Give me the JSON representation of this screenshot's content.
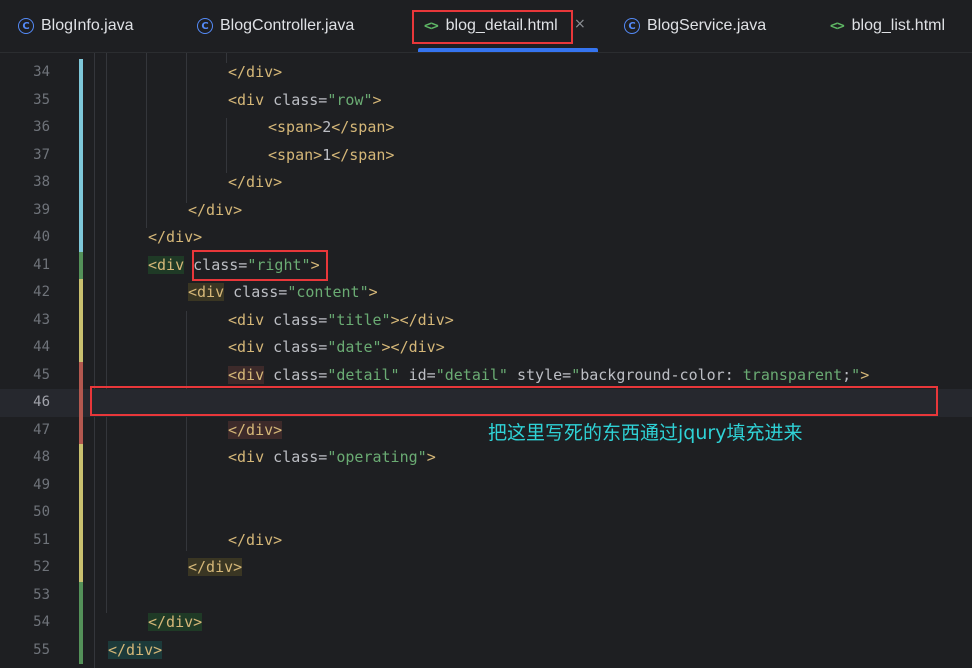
{
  "tabs": [
    {
      "label": "BlogInfo.java",
      "icon": "class-icon"
    },
    {
      "label": "BlogController.java",
      "icon": "class-icon"
    },
    {
      "label": "blog_detail.html",
      "icon": "html-icon",
      "active": true
    },
    {
      "label": "BlogService.java",
      "icon": "class-icon"
    },
    {
      "label": "blog_list.html",
      "icon": "html-icon"
    }
  ],
  "close_glyph": "×",
  "html_glyph": "<>",
  "class_glyph": "C",
  "annotation": "把这里写死的东西通过jqury填充进来",
  "lines": [
    {
      "n": "34",
      "marker": "#7ec7d9",
      "indent": 3,
      "segs": [
        [
          "tag",
          "</div>"
        ]
      ]
    },
    {
      "n": "35",
      "marker": "#7ec7d9",
      "indent": 3,
      "segs": [
        [
          "tag",
          "<div "
        ],
        [
          "attr",
          "class="
        ],
        [
          "str",
          "\"row\""
        ],
        [
          "tag",
          ">"
        ]
      ]
    },
    {
      "n": "36",
      "marker": "#7ec7d9",
      "indent": 4,
      "segs": [
        [
          "tag",
          "<span>"
        ],
        [
          "txt",
          "2"
        ],
        [
          "tag",
          "</span>"
        ]
      ]
    },
    {
      "n": "37",
      "marker": "#7ec7d9",
      "indent": 4,
      "segs": [
        [
          "tag",
          "<span>"
        ],
        [
          "txt",
          "1"
        ],
        [
          "tag",
          "</span>"
        ]
      ]
    },
    {
      "n": "38",
      "marker": "#7ec7d9",
      "indent": 3,
      "segs": [
        [
          "tag",
          "</div>"
        ]
      ]
    },
    {
      "n": "39",
      "marker": "#7ec7d9",
      "indent": 2,
      "segs": [
        [
          "tag",
          "</div>"
        ]
      ]
    },
    {
      "n": "40",
      "marker": "#7ec7d9",
      "indent": 1,
      "segs": [
        [
          "tag",
          "</div>"
        ]
      ]
    },
    {
      "n": "41",
      "marker": "#549159",
      "indent": 1,
      "segs": [
        [
          "tag hl-green",
          "<div"
        ],
        [
          "txt",
          " "
        ],
        [
          "attr",
          "class="
        ],
        [
          "str",
          "\"right\""
        ],
        [
          "tag",
          ">"
        ]
      ]
    },
    {
      "n": "42",
      "marker": "#c9c06f",
      "indent": 2,
      "segs": [
        [
          "tag hl-yellow",
          "<div"
        ],
        [
          "txt",
          " "
        ],
        [
          "attr",
          "class="
        ],
        [
          "str",
          "\"content\""
        ],
        [
          "tag",
          ">"
        ]
      ]
    },
    {
      "n": "43",
      "marker": "#c9c06f",
      "indent": 3,
      "segs": [
        [
          "tag",
          "<div "
        ],
        [
          "attr",
          "class="
        ],
        [
          "str",
          "\"title\""
        ],
        [
          "tag",
          "></div>"
        ]
      ]
    },
    {
      "n": "44",
      "marker": "#c9c06f",
      "indent": 3,
      "segs": [
        [
          "tag",
          "<div "
        ],
        [
          "attr",
          "class="
        ],
        [
          "str",
          "\"date\""
        ],
        [
          "tag",
          "></div>"
        ]
      ]
    },
    {
      "n": "45",
      "marker": "#b3584f",
      "indent": 3,
      "segs": [
        [
          "tag hl-red",
          "<div"
        ],
        [
          "txt",
          " "
        ],
        [
          "attr",
          "class="
        ],
        [
          "str",
          "\"detail\""
        ],
        [
          "txt",
          " "
        ],
        [
          "attr",
          "id="
        ],
        [
          "str",
          "\"detail\""
        ],
        [
          "txt",
          " "
        ],
        [
          "attr",
          "style="
        ],
        [
          "str",
          "\""
        ],
        [
          "txt",
          "background-color: "
        ],
        [
          "str",
          "transparent"
        ],
        [
          "txt",
          ";"
        ],
        [
          "str",
          "\""
        ],
        [
          "tag",
          ">"
        ]
      ]
    },
    {
      "n": "46",
      "marker": "#b3584f",
      "indent": 0,
      "current": true,
      "segs": []
    },
    {
      "n": "47",
      "marker": "#b3584f",
      "indent": 3,
      "segs": [
        [
          "tag hl-red",
          "</div>"
        ]
      ]
    },
    {
      "n": "48",
      "marker": "#c9c06f",
      "indent": 3,
      "segs": [
        [
          "tag",
          "<div "
        ],
        [
          "attr",
          "class="
        ],
        [
          "str",
          "\"operating\""
        ],
        [
          "tag",
          ">"
        ]
      ]
    },
    {
      "n": "49",
      "marker": "#c9c06f",
      "indent": 0,
      "segs": []
    },
    {
      "n": "50",
      "marker": "#c9c06f",
      "indent": 0,
      "segs": []
    },
    {
      "n": "51",
      "marker": "#c9c06f",
      "indent": 3,
      "segs": [
        [
          "tag",
          "</div>"
        ]
      ]
    },
    {
      "n": "52",
      "marker": "#c9c06f",
      "indent": 2,
      "segs": [
        [
          "tag hl-yellow",
          "</div>"
        ]
      ]
    },
    {
      "n": "53",
      "marker": "#549159",
      "indent": 0,
      "segs": []
    },
    {
      "n": "54",
      "marker": "#549159",
      "indent": 1,
      "segs": [
        [
          "tag hl-green",
          "</div>"
        ]
      ]
    },
    {
      "n": "55",
      "marker": "#549159",
      "indent": 0,
      "segs": [
        [
          "tag hl-teal",
          "</div>"
        ]
      ]
    }
  ]
}
